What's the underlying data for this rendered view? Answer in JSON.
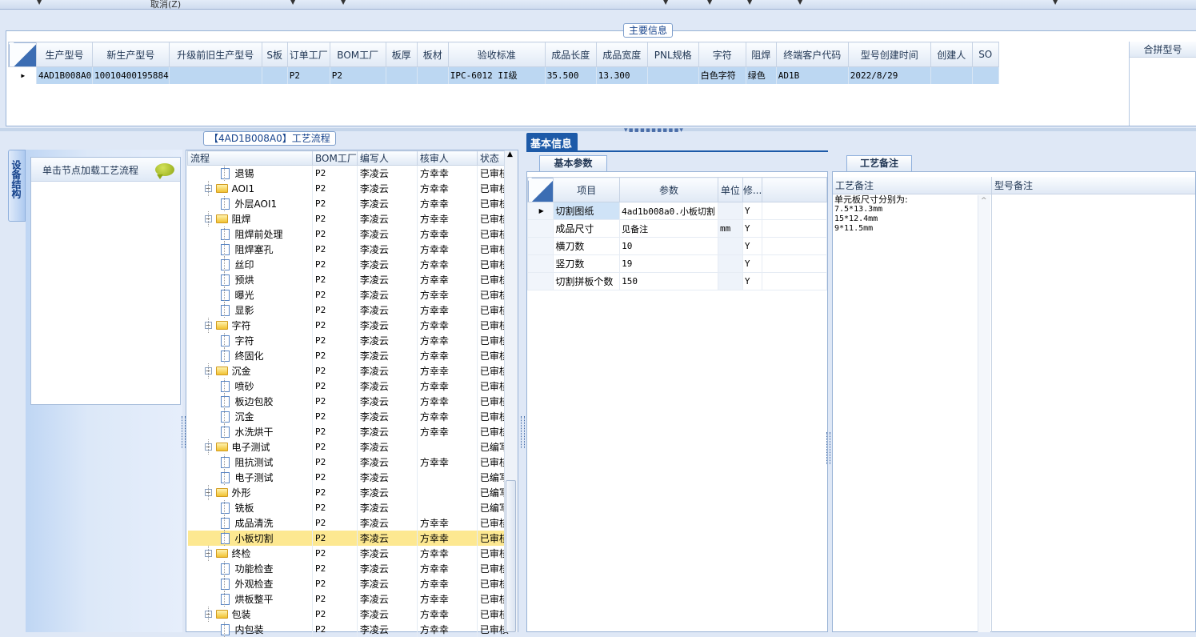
{
  "toolbar": {
    "cancel_label": "取消(Z)"
  },
  "main_info": {
    "title": "主要信息",
    "columns": [
      "生产型号",
      "新生产型号",
      "升级前旧生产型号",
      "S板",
      "订单工厂",
      "BOM工厂",
      "板厚",
      "板材",
      "验收标准",
      "成品长度",
      "成品宽度",
      "PNL规格",
      "字符",
      "阻焊",
      "终端客户代码",
      "型号创建时间",
      "创建人",
      "SO"
    ],
    "row": [
      "4AD1B008A0",
      "10010400195884",
      "",
      "",
      "P2",
      "P2",
      "",
      "",
      "IPC-6012 II级",
      "35.500",
      "13.300",
      "",
      "白色字符",
      "绿色",
      "AD1B",
      "2022/8/29",
      "",
      ""
    ],
    "merge_label": "合拼型号"
  },
  "side_tab": {
    "label": "设备结构"
  },
  "left_panel": {
    "load_label": "单击节点加载工艺流程"
  },
  "tree": {
    "title": "【4AD1B008A0】工艺流程",
    "columns": [
      "流程",
      "BOM工厂",
      "编写人",
      "核审人",
      "状态"
    ],
    "rows": [
      {
        "level": 1,
        "type": "doc",
        "name": "退锡",
        "bom": "P2",
        "writer": "李凌云",
        "reviewer": "方幸幸",
        "status": "已审核"
      },
      {
        "level": 0,
        "type": "folder",
        "name": "AOI1",
        "bom": "P2",
        "writer": "李凌云",
        "reviewer": "方幸幸",
        "status": "已审核"
      },
      {
        "level": 1,
        "type": "doc",
        "name": "外层AOI1",
        "bom": "P2",
        "writer": "李凌云",
        "reviewer": "方幸幸",
        "status": "已审核"
      },
      {
        "level": 0,
        "type": "folder",
        "name": "阻焊",
        "bom": "P2",
        "writer": "李凌云",
        "reviewer": "方幸幸",
        "status": "已审核"
      },
      {
        "level": 1,
        "type": "doc",
        "name": "阻焊前处理",
        "bom": "P2",
        "writer": "李凌云",
        "reviewer": "方幸幸",
        "status": "已审核"
      },
      {
        "level": 1,
        "type": "doc",
        "name": "阻焊塞孔",
        "bom": "P2",
        "writer": "李凌云",
        "reviewer": "方幸幸",
        "status": "已审核"
      },
      {
        "level": 1,
        "type": "doc",
        "name": "丝印",
        "bom": "P2",
        "writer": "李凌云",
        "reviewer": "方幸幸",
        "status": "已审核"
      },
      {
        "level": 1,
        "type": "doc",
        "name": "预烘",
        "bom": "P2",
        "writer": "李凌云",
        "reviewer": "方幸幸",
        "status": "已审核"
      },
      {
        "level": 1,
        "type": "doc",
        "name": "曝光",
        "bom": "P2",
        "writer": "李凌云",
        "reviewer": "方幸幸",
        "status": "已审核"
      },
      {
        "level": 1,
        "type": "doc",
        "name": "显影",
        "bom": "P2",
        "writer": "李凌云",
        "reviewer": "方幸幸",
        "status": "已审核"
      },
      {
        "level": 0,
        "type": "folder",
        "name": "字符",
        "bom": "P2",
        "writer": "李凌云",
        "reviewer": "方幸幸",
        "status": "已审核"
      },
      {
        "level": 1,
        "type": "doc",
        "name": "字符",
        "bom": "P2",
        "writer": "李凌云",
        "reviewer": "方幸幸",
        "status": "已审核"
      },
      {
        "level": 1,
        "type": "doc",
        "name": "终固化",
        "bom": "P2",
        "writer": "李凌云",
        "reviewer": "方幸幸",
        "status": "已审核"
      },
      {
        "level": 0,
        "type": "folder",
        "name": "沉金",
        "bom": "P2",
        "writer": "李凌云",
        "reviewer": "方幸幸",
        "status": "已审核"
      },
      {
        "level": 1,
        "type": "doc",
        "name": "喷砂",
        "bom": "P2",
        "writer": "李凌云",
        "reviewer": "方幸幸",
        "status": "已审核"
      },
      {
        "level": 1,
        "type": "doc",
        "name": "板边包胶",
        "bom": "P2",
        "writer": "李凌云",
        "reviewer": "方幸幸",
        "status": "已审核"
      },
      {
        "level": 1,
        "type": "doc",
        "name": "沉金",
        "bom": "P2",
        "writer": "李凌云",
        "reviewer": "方幸幸",
        "status": "已审核"
      },
      {
        "level": 1,
        "type": "doc",
        "name": "水洗烘干",
        "bom": "P2",
        "writer": "李凌云",
        "reviewer": "方幸幸",
        "status": "已审核"
      },
      {
        "level": 0,
        "type": "folder",
        "name": "电子测试",
        "bom": "P2",
        "writer": "李凌云",
        "reviewer": "",
        "status": "已编写"
      },
      {
        "level": 1,
        "type": "doc",
        "name": "阻抗测试",
        "bom": "P2",
        "writer": "李凌云",
        "reviewer": "方幸幸",
        "status": "已审核"
      },
      {
        "level": 1,
        "type": "doc",
        "name": "电子测试",
        "bom": "P2",
        "writer": "李凌云",
        "reviewer": "",
        "status": "已编写"
      },
      {
        "level": 0,
        "type": "folder",
        "name": "外形",
        "bom": "P2",
        "writer": "李凌云",
        "reviewer": "",
        "status": "已编写"
      },
      {
        "level": 1,
        "type": "doc",
        "name": "铣板",
        "bom": "P2",
        "writer": "李凌云",
        "reviewer": "",
        "status": "已编写"
      },
      {
        "level": 1,
        "type": "doc",
        "name": "成品清洗",
        "bom": "P2",
        "writer": "李凌云",
        "reviewer": "方幸幸",
        "status": "已审核"
      },
      {
        "level": 1,
        "type": "doc",
        "name": "小板切割",
        "bom": "P2",
        "writer": "李凌云",
        "reviewer": "方幸幸",
        "status": "已审核",
        "selected": true
      },
      {
        "level": 0,
        "type": "folder",
        "name": "终检",
        "bom": "P2",
        "writer": "李凌云",
        "reviewer": "方幸幸",
        "status": "已审核"
      },
      {
        "level": 1,
        "type": "doc",
        "name": "功能检查",
        "bom": "P2",
        "writer": "李凌云",
        "reviewer": "方幸幸",
        "status": "已审核"
      },
      {
        "level": 1,
        "type": "doc",
        "name": "外观检查",
        "bom": "P2",
        "writer": "李凌云",
        "reviewer": "方幸幸",
        "status": "已审核"
      },
      {
        "level": 1,
        "type": "doc",
        "name": "烘板整平",
        "bom": "P2",
        "writer": "李凌云",
        "reviewer": "方幸幸",
        "status": "已审核"
      },
      {
        "level": 0,
        "type": "folder",
        "name": "包装",
        "bom": "P2",
        "writer": "李凌云",
        "reviewer": "方幸幸",
        "status": "已审核"
      },
      {
        "level": 1,
        "type": "doc",
        "name": "内包装",
        "bom": "P2",
        "writer": "李凌云",
        "reviewer": "方幸幸",
        "status": "已审核"
      }
    ]
  },
  "basic": {
    "tab_label": "基本信息",
    "sub_tab_label": "基本参数",
    "columns": [
      "项目",
      "参数",
      "单位",
      "修..."
    ],
    "rows": [
      {
        "item": "切割图纸",
        "param": "4ad1b008a0.小板切割",
        "unit": "",
        "mod": "Y"
      },
      {
        "item": "成品尺寸",
        "param": "见备注",
        "unit": "mm",
        "mod": "Y"
      },
      {
        "item": "横刀数",
        "param": "10",
        "unit": "",
        "mod": "Y"
      },
      {
        "item": "竖刀数",
        "param": "19",
        "unit": "",
        "mod": "Y"
      },
      {
        "item": "切割拼板个数",
        "param": "150",
        "unit": "",
        "mod": "Y"
      }
    ]
  },
  "notes": {
    "tab_label": "工艺备注",
    "col1": "工艺备注",
    "col2": "型号备注",
    "title_line": "单元板尺寸分别为:",
    "lines": [
      "7.5*13.3mm",
      "15*12.4mm",
      "9*11.5mm"
    ]
  }
}
